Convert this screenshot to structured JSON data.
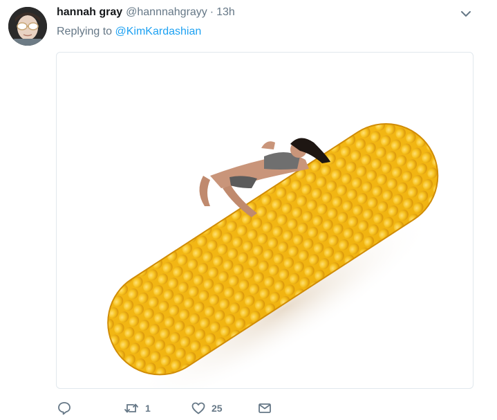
{
  "tweet": {
    "author_name": "hannah gray",
    "author_handle": "@hannnahgrayy",
    "separator": "·",
    "timestamp": "13h",
    "reply_prefix": "Replying to",
    "reply_mention": "@KimKardashian"
  },
  "actions": {
    "reply_icon": "reply-bubble-icon",
    "retweet_icon": "retweet-icon",
    "retweet_count": "1",
    "like_icon": "heart-icon",
    "like_count": "25",
    "dm_icon": "envelope-icon"
  },
  "colors": {
    "accent": "#1da1f2",
    "secondary_text": "#657786",
    "border": "#e1e8ed"
  }
}
